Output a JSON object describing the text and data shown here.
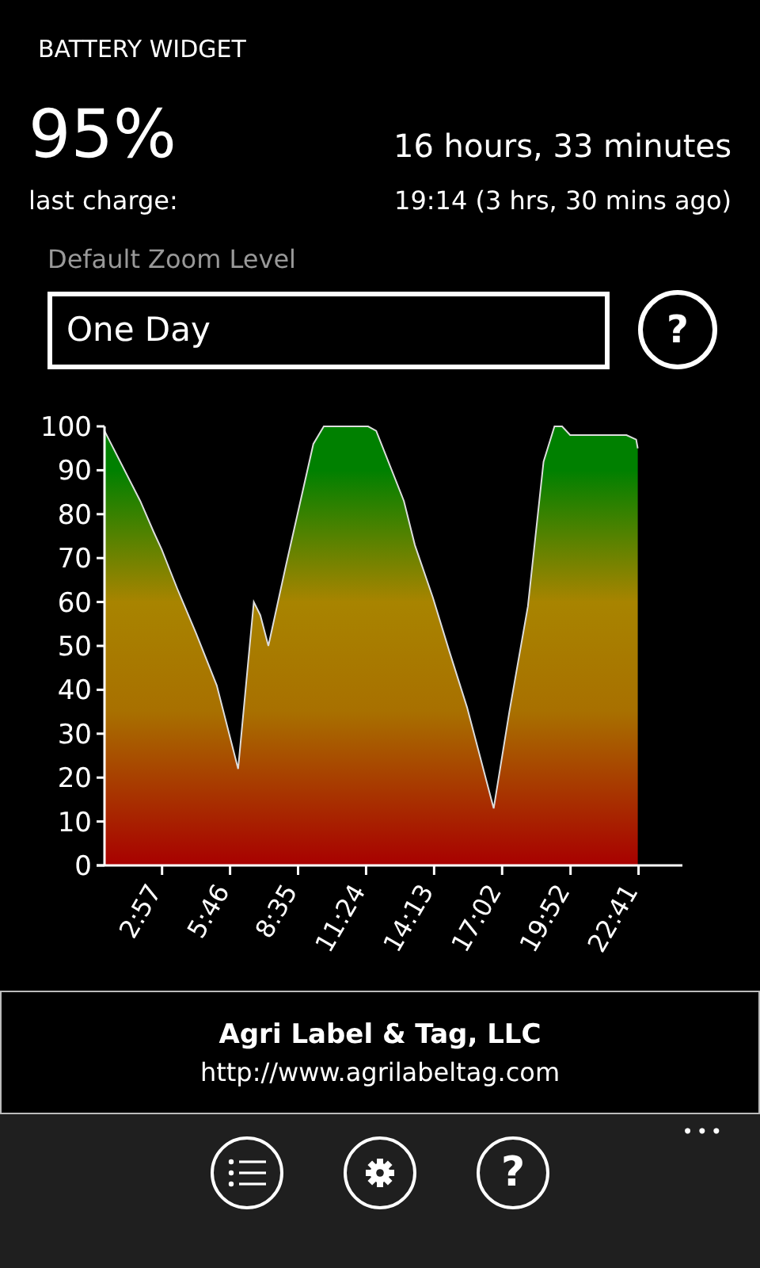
{
  "title": "BATTERY WIDGET",
  "battery": {
    "percent": "95%",
    "remaining": "16 hours, 33 minutes",
    "last_charge_label": "last charge:",
    "last_charge_value": "19:14 (3 hrs, 30 mins ago)"
  },
  "zoom": {
    "label": "Default Zoom Level",
    "value": "One Day",
    "help": "?"
  },
  "chart_data": {
    "type": "area",
    "x": [
      34,
      123,
      156,
      176,
      215,
      261,
      313,
      366,
      405,
      421,
      441,
      484,
      553,
      579,
      689,
      709,
      778,
      805,
      850,
      890,
      935,
      1001,
      1040,
      1086,
      1125,
      1152,
      1171,
      1191,
      1331,
      1355,
      1359
    ],
    "series": [
      {
        "color": "#008000",
        "values": [
          99,
          83,
          76,
          72,
          63,
          53,
          41,
          22,
          60,
          57,
          50,
          68,
          96,
          100,
          100,
          99,
          83,
          73,
          61,
          49,
          36,
          13,
          35,
          59,
          92,
          100,
          100,
          98,
          98,
          97,
          95
        ]
      }
    ],
    "xlim": [
      34,
      1470
    ],
    "ylim": [
      0,
      100
    ],
    "xticks": [
      {
        "value": 177,
        "label": "2:57"
      },
      {
        "value": 346,
        "label": "5:46"
      },
      {
        "value": 515,
        "label": "8:35"
      },
      {
        "value": 684,
        "label": "11:24"
      },
      {
        "value": 853,
        "label": "14:13"
      },
      {
        "value": 1022,
        "label": "17:02"
      },
      {
        "value": 1192,
        "label": "19:52"
      },
      {
        "value": 1361,
        "label": "22:41"
      }
    ],
    "yticks": [
      0,
      10,
      20,
      30,
      40,
      50,
      60,
      70,
      80,
      90,
      100
    ]
  },
  "ad": {
    "company": "Agri Label & Tag, LLC",
    "url": "http://www.agrilabeltag.com"
  },
  "app_bar": {
    "buttons": [
      {
        "kind": "list"
      },
      {
        "kind": "settings"
      },
      {
        "kind": "help",
        "label": "?"
      }
    ],
    "more": "•••"
  }
}
